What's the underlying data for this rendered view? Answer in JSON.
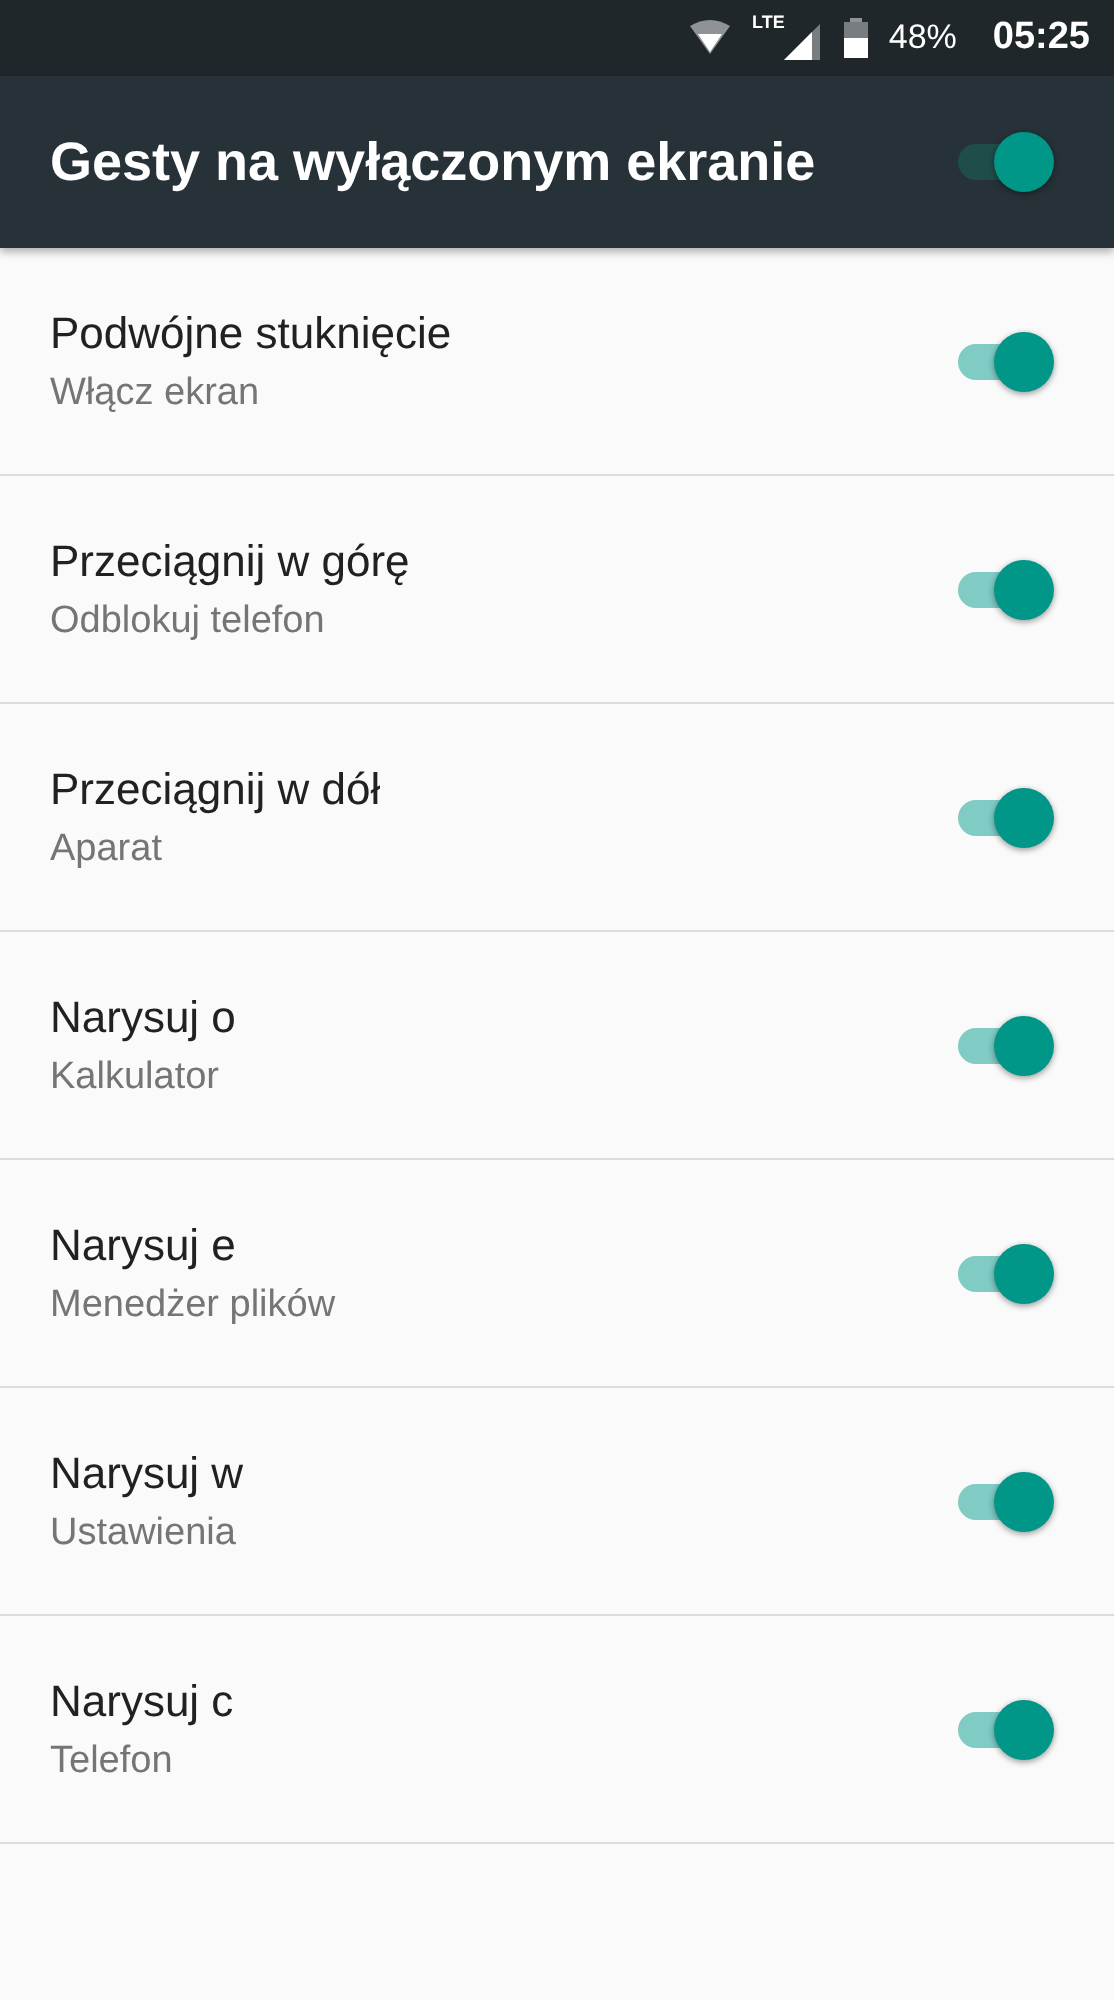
{
  "status_bar": {
    "network": "LTE",
    "battery": "48%",
    "time": "05:25"
  },
  "header": {
    "title": "Gesty na wyłączonym ekranie",
    "on": true
  },
  "settings": [
    {
      "title": "Podwójne stuknięcie",
      "subtitle": "Włącz ekran",
      "on": true
    },
    {
      "title": "Przeciągnij w górę",
      "subtitle": "Odblokuj telefon",
      "on": true
    },
    {
      "title": "Przeciągnij w dół",
      "subtitle": "Aparat",
      "on": true
    },
    {
      "title": "Narysuj o",
      "subtitle": "Kalkulator",
      "on": true
    },
    {
      "title": "Narysuj e",
      "subtitle": "Menedżer plików",
      "on": true
    },
    {
      "title": "Narysuj w",
      "subtitle": "Ustawienia",
      "on": true
    },
    {
      "title": "Narysuj c",
      "subtitle": "Telefon",
      "on": true
    }
  ]
}
